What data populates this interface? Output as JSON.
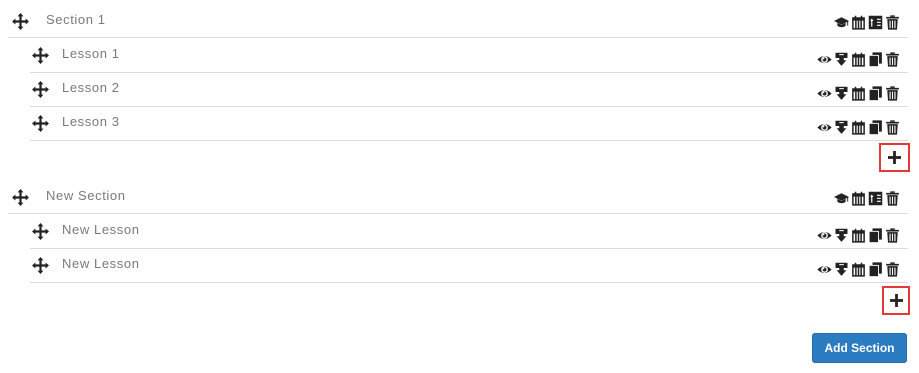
{
  "sections": [
    {
      "title": "Section 1",
      "icons": [
        "graduation-cap-icon",
        "calendar-icon",
        "reorder-icon",
        "trash-icon"
      ],
      "lessons": [
        {
          "title": "Lesson 1",
          "icons": [
            "eye-icon",
            "download-icon",
            "calendar-icon",
            "copy-icon",
            "trash-icon"
          ]
        },
        {
          "title": "Lesson 2",
          "icons": [
            "eye-icon",
            "download-icon",
            "calendar-icon",
            "copy-icon",
            "trash-icon"
          ]
        },
        {
          "title": "Lesson 3",
          "icons": [
            "eye-icon",
            "download-icon",
            "calendar-icon",
            "copy-icon",
            "trash-icon"
          ]
        }
      ],
      "add_lesson_icon": "plus-icon"
    },
    {
      "title": "New Section",
      "icons": [
        "graduation-cap-icon",
        "calendar-icon",
        "reorder-icon",
        "trash-icon"
      ],
      "lessons": [
        {
          "title": "New Lesson",
          "icons": [
            "eye-icon",
            "download-icon",
            "calendar-icon",
            "copy-icon",
            "trash-icon"
          ]
        },
        {
          "title": "New Lesson",
          "icons": [
            "eye-icon",
            "download-icon",
            "calendar-icon",
            "copy-icon",
            "trash-icon"
          ]
        }
      ],
      "add_lesson_icon": "plus-icon"
    }
  ],
  "add_section_label": "Add Section",
  "colors": {
    "icon": "#222222",
    "title_text": "#7a7a7a",
    "divider": "#dcdcdc",
    "highlight": "#e53935",
    "button_bg": "#2b7cc1",
    "button_text": "#ffffff"
  }
}
